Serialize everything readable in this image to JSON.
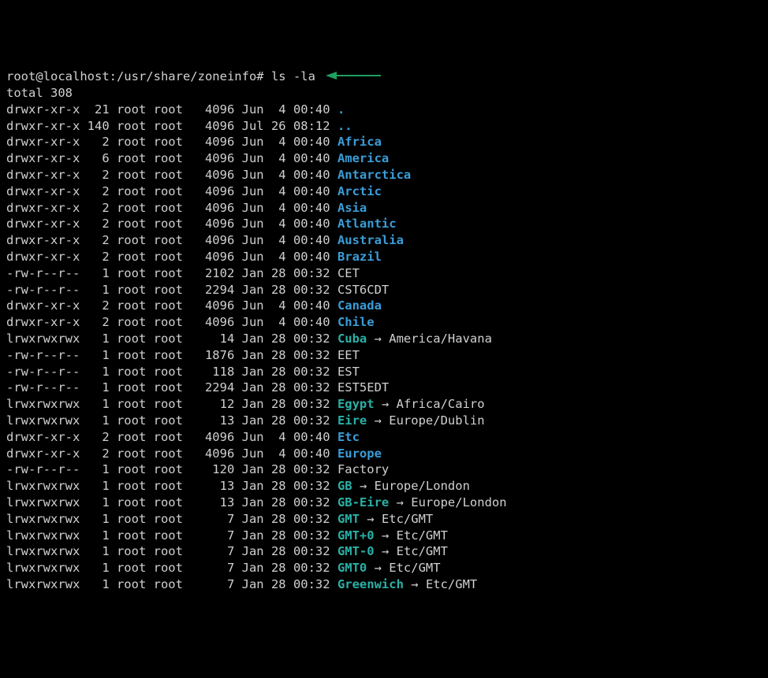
{
  "prompt": "root@localhost:/usr/share/zoneinfo# ",
  "command": "ls -la",
  "total_line": "total 308",
  "entries": [
    {
      "perms": "drwxr-xr-x",
      "links": " 21",
      "owner": "root",
      "group": "root",
      "size": "  4096",
      "date": "Jun  4 00:40",
      "name": ".",
      "kind": "dir",
      "target": ""
    },
    {
      "perms": "drwxr-xr-x",
      "links": "140",
      "owner": "root",
      "group": "root",
      "size": "  4096",
      "date": "Jul 26 08:12",
      "name": "..",
      "kind": "dir",
      "target": ""
    },
    {
      "perms": "drwxr-xr-x",
      "links": "  2",
      "owner": "root",
      "group": "root",
      "size": "  4096",
      "date": "Jun  4 00:40",
      "name": "Africa",
      "kind": "dir",
      "target": ""
    },
    {
      "perms": "drwxr-xr-x",
      "links": "  6",
      "owner": "root",
      "group": "root",
      "size": "  4096",
      "date": "Jun  4 00:40",
      "name": "America",
      "kind": "dir",
      "target": ""
    },
    {
      "perms": "drwxr-xr-x",
      "links": "  2",
      "owner": "root",
      "group": "root",
      "size": "  4096",
      "date": "Jun  4 00:40",
      "name": "Antarctica",
      "kind": "dir",
      "target": ""
    },
    {
      "perms": "drwxr-xr-x",
      "links": "  2",
      "owner": "root",
      "group": "root",
      "size": "  4096",
      "date": "Jun  4 00:40",
      "name": "Arctic",
      "kind": "dir",
      "target": ""
    },
    {
      "perms": "drwxr-xr-x",
      "links": "  2",
      "owner": "root",
      "group": "root",
      "size": "  4096",
      "date": "Jun  4 00:40",
      "name": "Asia",
      "kind": "dir",
      "target": ""
    },
    {
      "perms": "drwxr-xr-x",
      "links": "  2",
      "owner": "root",
      "group": "root",
      "size": "  4096",
      "date": "Jun  4 00:40",
      "name": "Atlantic",
      "kind": "dir",
      "target": ""
    },
    {
      "perms": "drwxr-xr-x",
      "links": "  2",
      "owner": "root",
      "group": "root",
      "size": "  4096",
      "date": "Jun  4 00:40",
      "name": "Australia",
      "kind": "dir",
      "target": ""
    },
    {
      "perms": "drwxr-xr-x",
      "links": "  2",
      "owner": "root",
      "group": "root",
      "size": "  4096",
      "date": "Jun  4 00:40",
      "name": "Brazil",
      "kind": "dir",
      "target": ""
    },
    {
      "perms": "-rw-r--r--",
      "links": "  1",
      "owner": "root",
      "group": "root",
      "size": "  2102",
      "date": "Jan 28 00:32",
      "name": "CET",
      "kind": "file",
      "target": ""
    },
    {
      "perms": "-rw-r--r--",
      "links": "  1",
      "owner": "root",
      "group": "root",
      "size": "  2294",
      "date": "Jan 28 00:32",
      "name": "CST6CDT",
      "kind": "file",
      "target": ""
    },
    {
      "perms": "drwxr-xr-x",
      "links": "  2",
      "owner": "root",
      "group": "root",
      "size": "  4096",
      "date": "Jun  4 00:40",
      "name": "Canada",
      "kind": "dir",
      "target": ""
    },
    {
      "perms": "drwxr-xr-x",
      "links": "  2",
      "owner": "root",
      "group": "root",
      "size": "  4096",
      "date": "Jun  4 00:40",
      "name": "Chile",
      "kind": "dir",
      "target": ""
    },
    {
      "perms": "lrwxrwxrwx",
      "links": "  1",
      "owner": "root",
      "group": "root",
      "size": "    14",
      "date": "Jan 28 00:32",
      "name": "Cuba",
      "kind": "symlink",
      "target": "America/Havana"
    },
    {
      "perms": "-rw-r--r--",
      "links": "  1",
      "owner": "root",
      "group": "root",
      "size": "  1876",
      "date": "Jan 28 00:32",
      "name": "EET",
      "kind": "file",
      "target": ""
    },
    {
      "perms": "-rw-r--r--",
      "links": "  1",
      "owner": "root",
      "group": "root",
      "size": "   118",
      "date": "Jan 28 00:32",
      "name": "EST",
      "kind": "file",
      "target": ""
    },
    {
      "perms": "-rw-r--r--",
      "links": "  1",
      "owner": "root",
      "group": "root",
      "size": "  2294",
      "date": "Jan 28 00:32",
      "name": "EST5EDT",
      "kind": "file",
      "target": ""
    },
    {
      "perms": "lrwxrwxrwx",
      "links": "  1",
      "owner": "root",
      "group": "root",
      "size": "    12",
      "date": "Jan 28 00:32",
      "name": "Egypt",
      "kind": "symlink",
      "target": "Africa/Cairo"
    },
    {
      "perms": "lrwxrwxrwx",
      "links": "  1",
      "owner": "root",
      "group": "root",
      "size": "    13",
      "date": "Jan 28 00:32",
      "name": "Eire",
      "kind": "symlink",
      "target": "Europe/Dublin"
    },
    {
      "perms": "drwxr-xr-x",
      "links": "  2",
      "owner": "root",
      "group": "root",
      "size": "  4096",
      "date": "Jun  4 00:40",
      "name": "Etc",
      "kind": "dir",
      "target": ""
    },
    {
      "perms": "drwxr-xr-x",
      "links": "  2",
      "owner": "root",
      "group": "root",
      "size": "  4096",
      "date": "Jun  4 00:40",
      "name": "Europe",
      "kind": "dir",
      "target": ""
    },
    {
      "perms": "-rw-r--r--",
      "links": "  1",
      "owner": "root",
      "group": "root",
      "size": "   120",
      "date": "Jan 28 00:32",
      "name": "Factory",
      "kind": "file",
      "target": ""
    },
    {
      "perms": "lrwxrwxrwx",
      "links": "  1",
      "owner": "root",
      "group": "root",
      "size": "    13",
      "date": "Jan 28 00:32",
      "name": "GB",
      "kind": "symlink",
      "target": "Europe/London"
    },
    {
      "perms": "lrwxrwxrwx",
      "links": "  1",
      "owner": "root",
      "group": "root",
      "size": "    13",
      "date": "Jan 28 00:32",
      "name": "GB-Eire",
      "kind": "symlink",
      "target": "Europe/London"
    },
    {
      "perms": "lrwxrwxrwx",
      "links": "  1",
      "owner": "root",
      "group": "root",
      "size": "     7",
      "date": "Jan 28 00:32",
      "name": "GMT",
      "kind": "symlink",
      "target": "Etc/GMT"
    },
    {
      "perms": "lrwxrwxrwx",
      "links": "  1",
      "owner": "root",
      "group": "root",
      "size": "     7",
      "date": "Jan 28 00:32",
      "name": "GMT+0",
      "kind": "symlink",
      "target": "Etc/GMT"
    },
    {
      "perms": "lrwxrwxrwx",
      "links": "  1",
      "owner": "root",
      "group": "root",
      "size": "     7",
      "date": "Jan 28 00:32",
      "name": "GMT-0",
      "kind": "symlink",
      "target": "Etc/GMT"
    },
    {
      "perms": "lrwxrwxrwx",
      "links": "  1",
      "owner": "root",
      "group": "root",
      "size": "     7",
      "date": "Jan 28 00:32",
      "name": "GMT0",
      "kind": "symlink",
      "target": "Etc/GMT"
    },
    {
      "perms": "lrwxrwxrwx",
      "links": "  1",
      "owner": "root",
      "group": "root",
      "size": "     7",
      "date": "Jan 28 00:32",
      "name": "Greenwich",
      "kind": "symlink",
      "target": "Etc/GMT"
    }
  ]
}
